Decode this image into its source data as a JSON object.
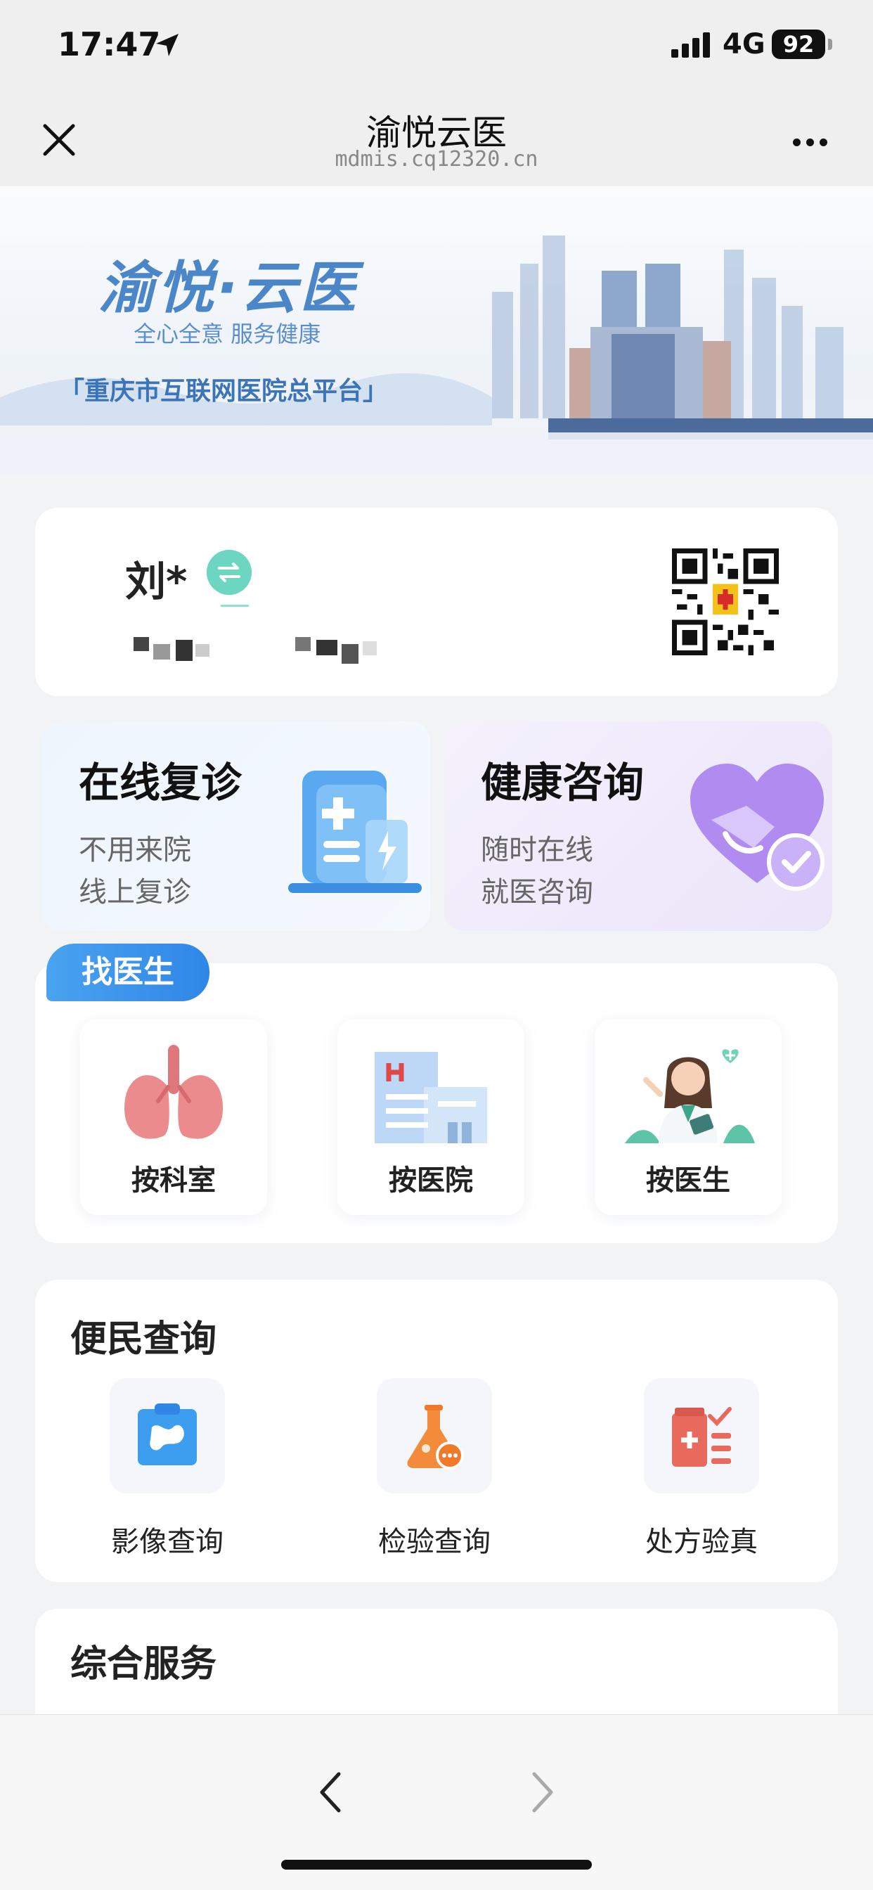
{
  "status_bar": {
    "time": "17:47",
    "network": "4G",
    "battery": "92"
  },
  "nav": {
    "title": "渝悦云医",
    "url": "mdmis.cq12320.cn"
  },
  "banner": {
    "title": "渝悦·云医",
    "subtitle": "全心全意 服务健康",
    "platform": "「重庆市互联网医院总平台」"
  },
  "user": {
    "name": "刘*"
  },
  "services": [
    {
      "title": "在线复诊",
      "line1": "不用来院",
      "line2": "线上复诊"
    },
    {
      "title": "健康咨询",
      "line1": "随时在线",
      "line2": "就医咨询"
    }
  ],
  "find_doctor": {
    "tag": "找医生",
    "items": [
      {
        "label": "按科室",
        "icon": "lungs-icon"
      },
      {
        "label": "按医院",
        "icon": "hospital-icon"
      },
      {
        "label": "按医生",
        "icon": "doctor-icon"
      }
    ]
  },
  "convenience": {
    "title": "便民查询",
    "items": [
      {
        "label": "影像查询",
        "icon": "xray-icon"
      },
      {
        "label": "检验查询",
        "icon": "flask-icon"
      },
      {
        "label": "处方验真",
        "icon": "prescription-icon"
      }
    ]
  },
  "comprehensive": {
    "title": "综合服务"
  },
  "colors": {
    "accent_blue": "#2f86e6",
    "teal": "#6dd6c1",
    "purple": "#a07be8",
    "orange": "#f07a2a",
    "coral": "#e86a5c"
  }
}
